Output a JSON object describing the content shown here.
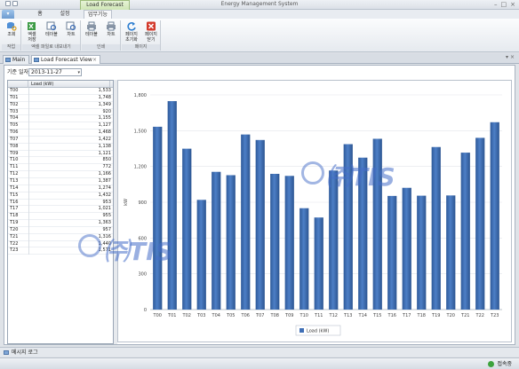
{
  "window": {
    "context_tab": "Load Forecast View",
    "title": "Energy Management System",
    "controls": [
      "–",
      "□",
      "×"
    ]
  },
  "ribbon_tabs": [
    "홈",
    "설정",
    "업무기능"
  ],
  "ribbon": {
    "groups": [
      {
        "label": "작업",
        "buttons": [
          {
            "label": "조회",
            "icon": "search-db-icon"
          }
        ]
      },
      {
        "label": "엑셀 파일로 내보내기",
        "buttons": [
          {
            "label": "엑셀\n저장",
            "icon": "excel-save-icon"
          },
          {
            "label": "테이블",
            "icon": "table-preview-icon"
          },
          {
            "label": "차트",
            "icon": "chart-preview-icon"
          }
        ]
      },
      {
        "label": "인쇄",
        "buttons": [
          {
            "label": "테이블",
            "icon": "table-print-icon"
          },
          {
            "label": "차트",
            "icon": "chart-print-icon"
          }
        ]
      },
      {
        "label": "페이지",
        "buttons": [
          {
            "label": "페이지\n초기화",
            "icon": "refresh-icon"
          },
          {
            "label": "페이지\n닫기",
            "icon": "close-page-icon"
          }
        ]
      }
    ]
  },
  "doc_tabs": [
    {
      "label": "Main",
      "active": false
    },
    {
      "label": "Load Forecast View",
      "active": true
    }
  ],
  "filter": {
    "label": "기준 일자",
    "date": "2013-11-27"
  },
  "grid": {
    "header": "Load (kW)",
    "rows": [
      {
        "key": "T00",
        "value": "1,533"
      },
      {
        "key": "T01",
        "value": "1,748"
      },
      {
        "key": "T02",
        "value": "1,349"
      },
      {
        "key": "T03",
        "value": "920"
      },
      {
        "key": "T04",
        "value": "1,155"
      },
      {
        "key": "T05",
        "value": "1,127"
      },
      {
        "key": "T06",
        "value": "1,468"
      },
      {
        "key": "T07",
        "value": "1,422"
      },
      {
        "key": "T08",
        "value": "1,138"
      },
      {
        "key": "T09",
        "value": "1,121"
      },
      {
        "key": "T10",
        "value": "850"
      },
      {
        "key": "T11",
        "value": "772"
      },
      {
        "key": "T12",
        "value": "1,166"
      },
      {
        "key": "T13",
        "value": "1,387"
      },
      {
        "key": "T14",
        "value": "1,274"
      },
      {
        "key": "T15",
        "value": "1,432"
      },
      {
        "key": "T16",
        "value": "953"
      },
      {
        "key": "T17",
        "value": "1,021"
      },
      {
        "key": "T18",
        "value": "955"
      },
      {
        "key": "T19",
        "value": "1,363"
      },
      {
        "key": "T20",
        "value": "957"
      },
      {
        "key": "T21",
        "value": "1,316"
      },
      {
        "key": "T22",
        "value": "1,440"
      },
      {
        "key": "T23",
        "value": "1,571"
      }
    ]
  },
  "chart_data": {
    "type": "bar",
    "categories": [
      "T00",
      "T01",
      "T02",
      "T03",
      "T04",
      "T05",
      "T06",
      "T07",
      "T08",
      "T09",
      "T10",
      "T11",
      "T12",
      "T13",
      "T14",
      "T15",
      "T16",
      "T17",
      "T18",
      "T19",
      "T20",
      "T21",
      "T22",
      "T23"
    ],
    "series": [
      {
        "name": "Load (kW)",
        "values": [
          1533,
          1748,
          1349,
          920,
          1155,
          1127,
          1468,
          1422,
          1138,
          1121,
          850,
          772,
          1166,
          1387,
          1274,
          1432,
          953,
          1021,
          955,
          1363,
          957,
          1316,
          1440,
          1571
        ]
      }
    ],
    "ylabel": "kW",
    "ylim": [
      0,
      1800
    ],
    "yticks": [
      "0",
      "300",
      "600",
      "900",
      "1,200",
      "1,500",
      "1,800"
    ],
    "grid": true,
    "legend": "bottom-center",
    "bar_color": "#3f6fb6"
  },
  "watermark": "㈜TIS",
  "status": {
    "log_label": "메시지 로그",
    "connection": "접속중"
  }
}
